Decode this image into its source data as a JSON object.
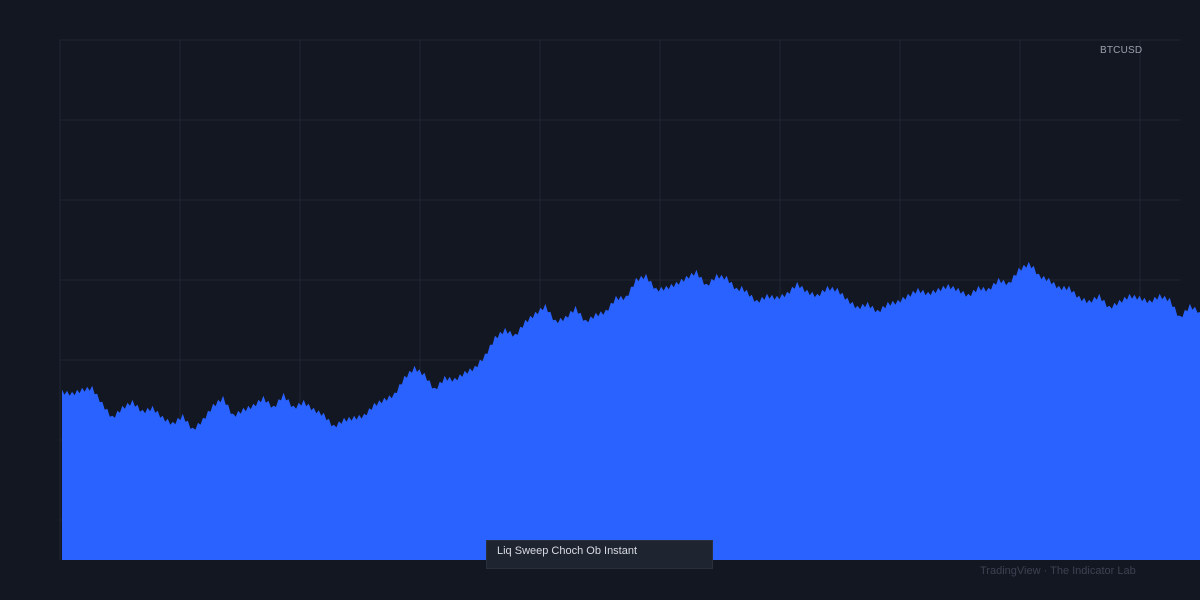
{
  "chart_data": {
    "type": "area",
    "symbol": "BTCUSD",
    "title": "",
    "xlabel": "",
    "ylabel": "",
    "ylim": [
      0,
      520
    ],
    "x_range": [
      0,
      113
    ],
    "grid": true,
    "fill_color": "#2962ff",
    "background_color": "#131722",
    "grid_color": "#222632",
    "x": [
      0,
      1,
      2,
      3,
      4,
      5,
      6,
      7,
      8,
      9,
      10,
      11,
      12,
      13,
      14,
      15,
      16,
      17,
      18,
      19,
      20,
      21,
      22,
      23,
      24,
      25,
      26,
      27,
      28,
      29,
      30,
      31,
      32,
      33,
      34,
      35,
      36,
      37,
      38,
      39,
      40,
      41,
      42,
      43,
      44,
      45,
      46,
      47,
      48,
      49,
      50,
      51,
      52,
      53,
      54,
      55,
      56,
      57,
      58,
      59,
      60,
      61,
      62,
      63,
      64,
      65,
      66,
      67,
      67.5,
      68,
      69,
      70,
      71,
      72,
      73,
      74,
      75,
      76,
      77,
      78,
      79,
      80,
      81,
      82,
      83,
      84,
      85,
      86,
      87,
      88,
      89,
      90,
      91,
      92,
      93,
      94,
      95,
      96,
      96.5,
      97,
      98,
      99,
      100,
      101,
      102,
      103,
      104,
      105,
      106,
      107,
      108,
      109,
      110,
      111,
      112,
      113
    ],
    "values": [
      168,
      166,
      170,
      172,
      156,
      142,
      152,
      158,
      148,
      152,
      142,
      136,
      144,
      130,
      140,
      154,
      162,
      144,
      150,
      154,
      162,
      152,
      165,
      152,
      158,
      150,
      145,
      133,
      140,
      142,
      144,
      155,
      160,
      165,
      182,
      192,
      185,
      170,
      182,
      180,
      187,
      192,
      204,
      222,
      230,
      224,
      238,
      246,
      254,
      238,
      242,
      252,
      238,
      245,
      248,
      262,
      262,
      280,
      284,
      270,
      272,
      276,
      282,
      288,
      274,
      284,
      282,
      270,
      272,
      268,
      258,
      264,
      262,
      266,
      276,
      268,
      264,
      272,
      270,
      260,
      252,
      256,
      248,
      256,
      258,
      264,
      270,
      266,
      270,
      274,
      270,
      264,
      272,
      270,
      280,
      276,
      290,
      296,
      292,
      284,
      280,
      272,
      272,
      262,
      258,
      264,
      252,
      258,
      264,
      262,
      258,
      264,
      260,
      242,
      254,
      248
    ]
  },
  "indicator_label": "Liq Sweep Choch Ob Instant",
  "watermark": "TradingView · The Indicator Lab"
}
